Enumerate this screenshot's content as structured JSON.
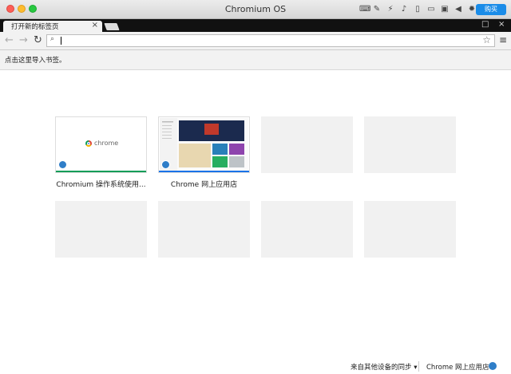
{
  "window": {
    "title": "Chromium OS",
    "buy_label": "购买"
  },
  "status_icons": [
    "keyboard-icon",
    "stylus-icon",
    "wifi-off-icon",
    "volume-icon",
    "phone-icon",
    "folder-icon",
    "display-icon",
    "play-icon",
    "brightness-icon"
  ],
  "tab": {
    "title": "打开新的标签页",
    "close": "×"
  },
  "toolbar": {
    "back": "←",
    "forward": "→",
    "reload": "↻",
    "search_glyph": "⌕",
    "star": "☆",
    "menu": "≡",
    "omnibox_value": ""
  },
  "window_controls": {
    "restore": "□",
    "close": "×"
  },
  "bookmarks": {
    "hint": "点击这里导入书签。"
  },
  "tiles": [
    {
      "label": "Chromium 操作系统使用...",
      "thumb_text": "chrome",
      "accent": "#0f9d58"
    },
    {
      "label": "Chrome 网上应用店",
      "accent": "#1a73e8"
    },
    {
      "label": ""
    },
    {
      "label": ""
    },
    {
      "label": ""
    },
    {
      "label": ""
    },
    {
      "label": ""
    },
    {
      "label": ""
    }
  ],
  "footer": {
    "sync": "来自其他设备的同步 ▾",
    "store": "Chrome 网上应用店"
  }
}
